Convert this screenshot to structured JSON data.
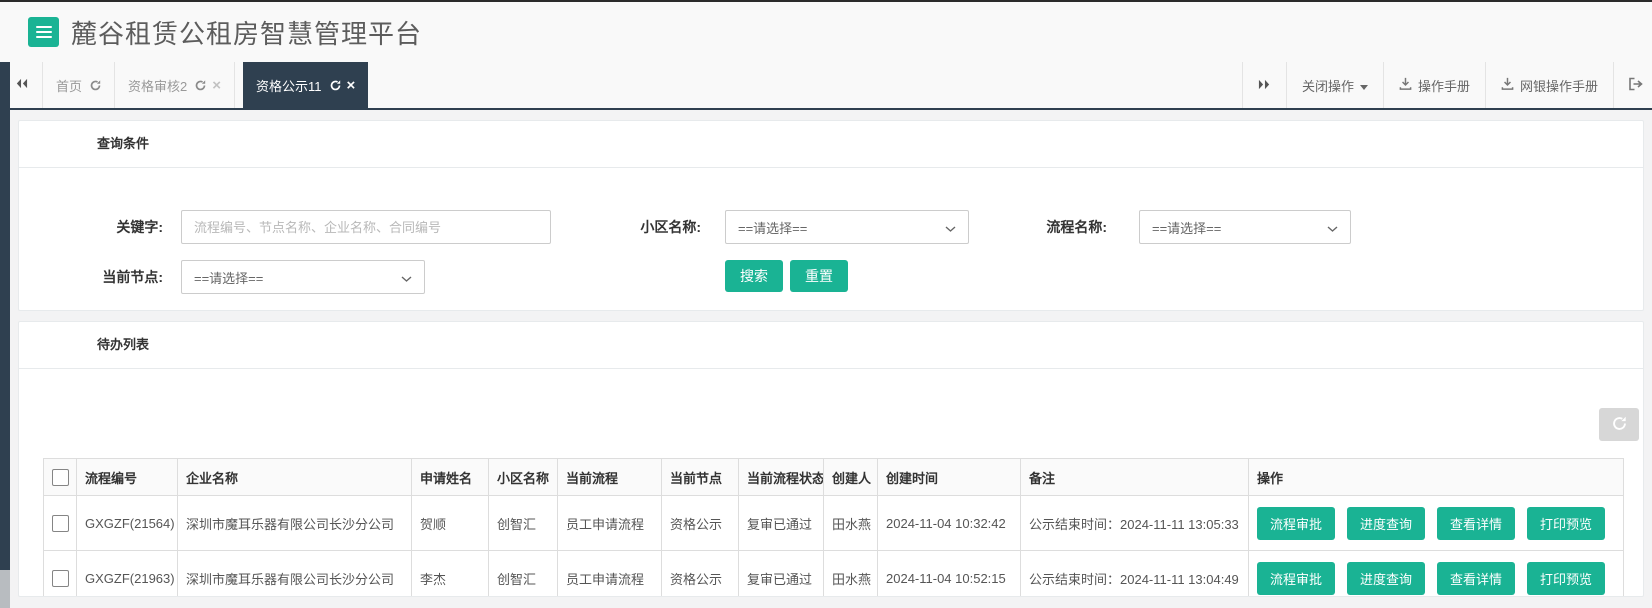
{
  "app": {
    "title": "麓谷租赁公租房智慧管理平台"
  },
  "colors": {
    "accent_green": "#1ab394",
    "navy_dark": "#2f4050",
    "page_bg": "#f3f3f4",
    "refresh_button_gray": "#d7d7d7"
  },
  "tabbar": {
    "tabs": [
      {
        "label": "首页",
        "active": false,
        "closable": false
      },
      {
        "label": "资格审核2",
        "active": false,
        "closable": true
      },
      {
        "label": "资格公示11",
        "active": true,
        "closable": true
      }
    ],
    "close_operations_label": "关闭操作",
    "operation_manual_label": "操作手册",
    "bank_manual_label": "网银操作手册"
  },
  "query": {
    "section_title": "查询条件",
    "keyword_label": "关键字:",
    "keyword_placeholder": "流程编号、节点名称、企业名称、合同编号",
    "community_label": "小区名称:",
    "process_name_label": "流程名称:",
    "current_node_label": "当前节点:",
    "select_placeholder": "==请选择==",
    "search_label": "搜索",
    "reset_label": "重置"
  },
  "todo": {
    "section_title": "待办列表",
    "columns": [
      "流程编号",
      "企业名称",
      "申请姓名",
      "小区名称",
      "当前流程",
      "当前节点",
      "当前流程状态",
      "创建人",
      "创建时间",
      "备注",
      "操作"
    ],
    "action_labels": [
      "流程审批",
      "进度查询",
      "查看详情",
      "打印预览"
    ],
    "rows": [
      {
        "code": "GXGZF(21564)",
        "company": "深圳市魔耳乐器有限公司长沙分公司",
        "applicant": "贺顺",
        "community": "创智汇",
        "process": "员工申请流程",
        "node": "资格公示",
        "status": "复审已通过",
        "creator": "田水燕",
        "created": "2024-11-04 10:32:42",
        "remark": "公示结束时间：2024-11-11 13:05:33"
      },
      {
        "code": "GXGZF(21963)",
        "company": "深圳市魔耳乐器有限公司长沙分公司",
        "applicant": "李杰",
        "community": "创智汇",
        "process": "员工申请流程",
        "node": "资格公示",
        "status": "复审已通过",
        "creator": "田水燕",
        "created": "2024-11-04 10:52:15",
        "remark": "公示结束时间：2024-11-11 13:04:49"
      }
    ]
  },
  "icons": {
    "menu": "hamburger-icon",
    "tab_refresh": "refresh-icon",
    "tab_close": "close-icon",
    "scroll_tabs_left": "double-chevron-left-icon",
    "scroll_tabs_right": "double-chevron-right-icon",
    "close_operations_caret": "caret-down-icon",
    "manual_download": "download-icon",
    "exit": "sign-out-icon",
    "select_arrow": "chevron-down-icon",
    "list_refresh": "refresh-icon"
  }
}
